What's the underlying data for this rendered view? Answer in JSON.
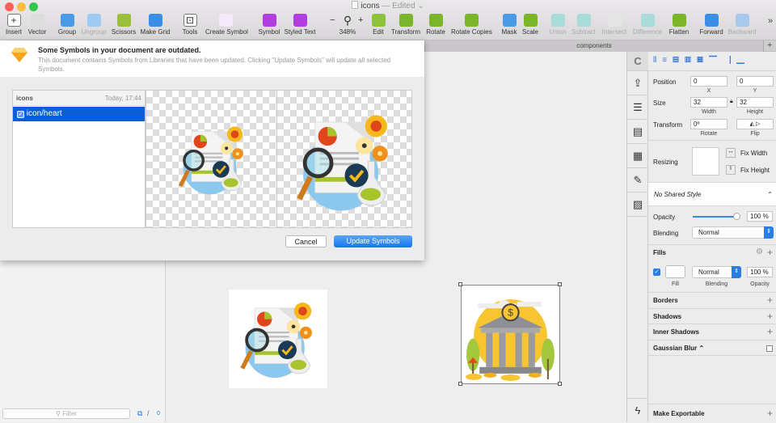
{
  "window": {
    "title": "icons",
    "status": "— Edited ⌄"
  },
  "toolbar": {
    "items": [
      {
        "label": "Insert",
        "icon": "plus-icon"
      },
      {
        "label": "Vector",
        "icon": "pen-icon"
      },
      {
        "label": "Group",
        "icon": "group-icon"
      },
      {
        "label": "Ungroup",
        "icon": "ungroup-icon",
        "disabled": true
      },
      {
        "label": "Scissors",
        "icon": "scissors-icon"
      },
      {
        "label": "Make Grid",
        "icon": "grid-icon"
      },
      {
        "label": "Tools",
        "icon": "tools-icon"
      },
      {
        "label": "Create Symbol",
        "icon": "create-symbol-icon"
      },
      {
        "label": "Symbol",
        "icon": "symbol-icon"
      },
      {
        "label": "Styled Text",
        "icon": "styled-text-icon"
      },
      {
        "label": "348%",
        "icon": "zoom-icon"
      },
      {
        "label": "Edit",
        "icon": "edit-icon"
      },
      {
        "label": "Transform",
        "icon": "transform-icon"
      },
      {
        "label": "Rotate",
        "icon": "rotate-icon"
      },
      {
        "label": "Rotate Copies",
        "icon": "rotate-copies-icon"
      },
      {
        "label": "Mask",
        "icon": "mask-icon"
      },
      {
        "label": "Scale",
        "icon": "scale-icon"
      },
      {
        "label": "Union",
        "icon": "union-icon",
        "disabled": true
      },
      {
        "label": "Subtract",
        "icon": "subtract-icon",
        "disabled": true
      },
      {
        "label": "Intersect",
        "icon": "intersect-icon",
        "disabled": true
      },
      {
        "label": "Difference",
        "icon": "difference-icon",
        "disabled": true
      },
      {
        "label": "Flatten",
        "icon": "flatten-icon"
      },
      {
        "label": "Forward",
        "icon": "forward-icon"
      },
      {
        "label": "Backward",
        "icon": "backward-icon",
        "disabled": true
      }
    ],
    "overflow": "»",
    "zoom_minus": "−",
    "zoom_plus": "+"
  },
  "tabs": {
    "page": "components",
    "add": "+"
  },
  "dialog": {
    "title": "Some Symbols in your document are outdated.",
    "message": "This document contains Symbols from Libraries that have been updated. Clicking \"Update Symbols\" will update all selected Symbols.",
    "library": "icons",
    "date": "Today, 17:44",
    "symbol": "icon/heart",
    "symbol_checked": true,
    "cancel": "Cancel",
    "update": "Update Symbols"
  },
  "sidebar": {
    "filter_placeholder": "Filter",
    "count": "0"
  },
  "inspector": {
    "position_label": "Position",
    "x": "0",
    "y": "0",
    "x_label": "X",
    "y_label": "Y",
    "size_label": "Size",
    "width": "32",
    "height": "32",
    "width_label": "Width",
    "height_label": "Height",
    "transform_label": "Transform",
    "rotate": "0º",
    "rotate_label": "Rotate",
    "flip_label": "Flip",
    "resizing_label": "Resizing",
    "fix_width": "Fix Width",
    "fix_height": "Fix Height",
    "shared_style": "No Shared Style",
    "opacity_label": "Opacity",
    "opacity": "100 %",
    "opacity_value": 100,
    "blending_label": "Blending",
    "blending": "Normal",
    "fills": "Fills",
    "fill_enabled": true,
    "fill_blending": "Normal",
    "fill_opacity": "100 %",
    "fill_label": "Fill",
    "fill_blending_label": "Blending",
    "fill_opacity_label": "Opacity",
    "fill_color": "#ffffff",
    "borders": "Borders",
    "shadows": "Shadows",
    "inner_shadows": "Inner Shadows",
    "gaussian_blur": "Gaussian Blur ⌃",
    "make_exportable": "Make Exportable"
  },
  "colors": {
    "accent": "#1a73e8",
    "selection": "#0a5fd6"
  }
}
